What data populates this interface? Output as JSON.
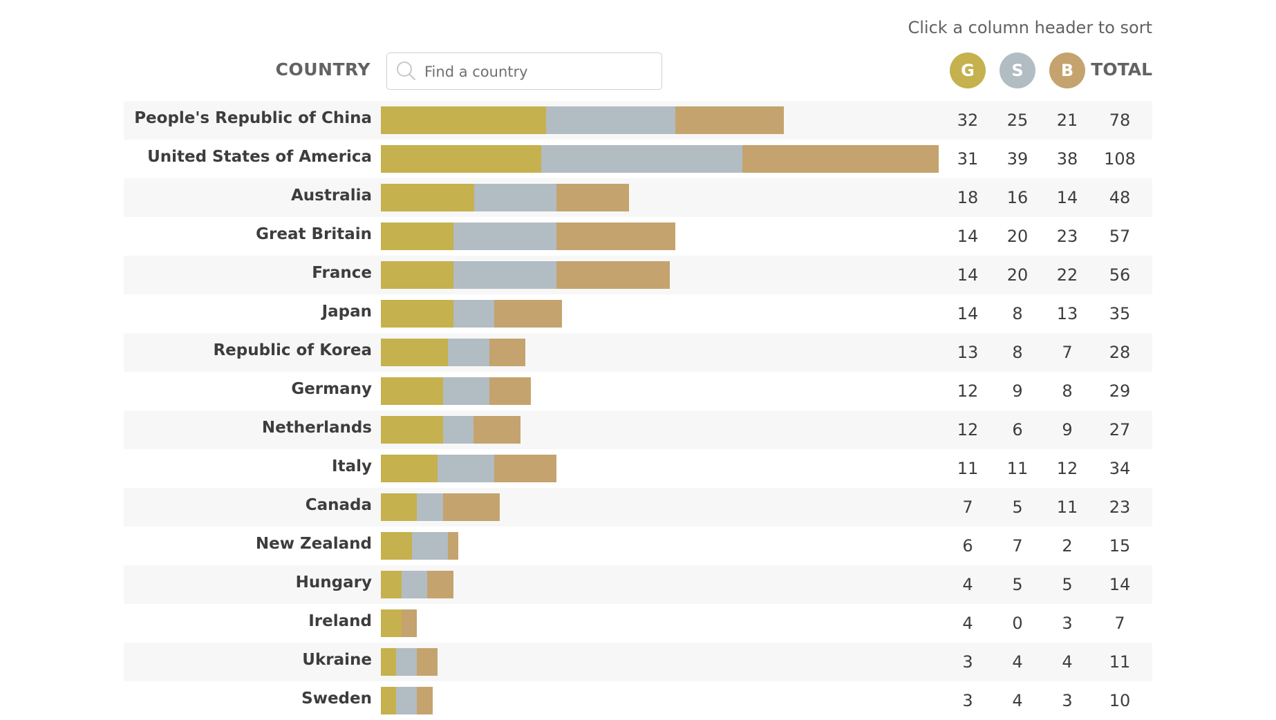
{
  "header": {
    "sort_hint": "Click a column header to sort",
    "country_label": "COUNTRY",
    "search_placeholder": "Find a country",
    "search_value": "",
    "gold_label": "G",
    "silver_label": "S",
    "bronze_label": "B",
    "total_label": "TOTAL"
  },
  "colors": {
    "gold": "#C5B14D",
    "silver": "#B2BCC3",
    "bronze": "#C4A36E",
    "row_alt": "#F7F7F7"
  },
  "chart_data": {
    "type": "bar",
    "stacked": true,
    "orientation": "horizontal",
    "title": "",
    "xlabel": "",
    "ylabel": "",
    "categories": [
      "People's Republic of China",
      "United States of America",
      "Australia",
      "Great Britain",
      "France",
      "Japan",
      "Republic of Korea",
      "Germany",
      "Netherlands",
      "Italy",
      "Canada",
      "New Zealand",
      "Hungary",
      "Ireland",
      "Ukraine",
      "Sweden"
    ],
    "series": [
      {
        "name": "Gold",
        "values": [
          32,
          31,
          18,
          14,
          14,
          14,
          13,
          12,
          12,
          11,
          7,
          6,
          4,
          4,
          3,
          3
        ]
      },
      {
        "name": "Silver",
        "values": [
          25,
          39,
          16,
          20,
          20,
          8,
          8,
          9,
          6,
          11,
          5,
          7,
          5,
          0,
          4,
          4
        ]
      },
      {
        "name": "Bronze",
        "values": [
          21,
          38,
          14,
          23,
          22,
          13,
          7,
          8,
          9,
          12,
          11,
          2,
          5,
          3,
          4,
          3
        ]
      }
    ],
    "totals": [
      78,
      108,
      48,
      57,
      56,
      35,
      28,
      29,
      27,
      34,
      23,
      15,
      14,
      7,
      11,
      10
    ],
    "xlim": [
      0,
      108
    ],
    "grid": false,
    "legend": "top-right"
  }
}
